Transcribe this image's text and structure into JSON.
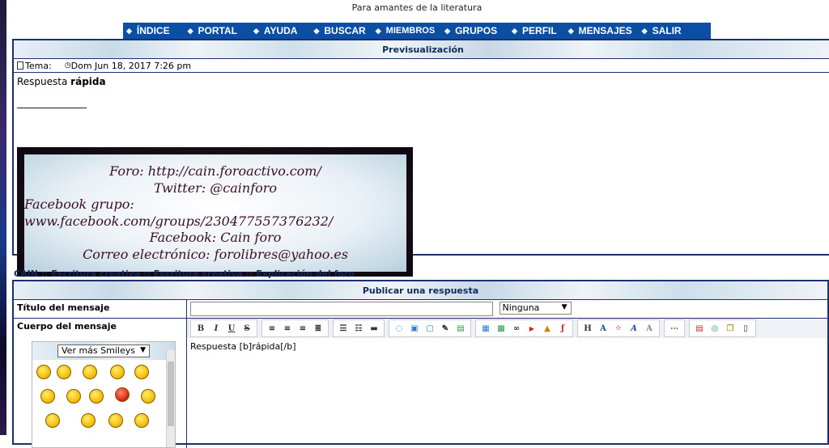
{
  "site": {
    "tagline": "Para amantes de la literatura"
  },
  "nav": {
    "items": [
      {
        "label": "ÍNDICE"
      },
      {
        "label": "PORTAL"
      },
      {
        "label": "AYUDA"
      },
      {
        "label": "BUSCAR"
      },
      {
        "label": "MIEMBROS"
      },
      {
        "label": "GRUPOS"
      },
      {
        "label": "PERFIL"
      },
      {
        "label": "MENSAJES"
      },
      {
        "label": "SALIR"
      }
    ]
  },
  "preview": {
    "header": "Previsualización",
    "topic_label": "Tema:",
    "date": "Dom Jun 18, 2017 7:26 pm",
    "body_plain": "Respuesta ",
    "body_bold": "rápida",
    "signature_rule": "_________________",
    "signature_lines": [
      "Foro: http://cain.foroactivo.com/",
      "Twitter: @cainforo",
      "Facebook grupo:  www.facebook.com/groups/230477557376232/",
      "Facebook: Cain foro",
      "Correo electrónico: forolibres@yahoo.es"
    ]
  },
  "breadcrumb": "CAIN  :: Escritura creativa :: Escritura creativa :: Explicación del foro",
  "reply": {
    "header": "Publicar una respuesta",
    "title_label": "Título del mensaje",
    "title_value": "",
    "icon_select": "Ninguna",
    "body_label": "Cuerpo del mensaje",
    "smiley_select": "Ver más Smileys",
    "editor_text": "Respuesta [b]rápida[/b]"
  },
  "toolbar": {
    "groups": [
      [
        "B",
        "I",
        "U",
        "S"
      ],
      [
        "align-left",
        "align-center",
        "align-right",
        "justify"
      ],
      [
        "bullet-list",
        "numbered-list",
        "horizontal-rule"
      ],
      [
        "speech",
        "image-upload",
        "insert-image",
        "edit-image",
        "attach"
      ],
      [
        "gallery",
        "media",
        "link",
        "youtube",
        "warning",
        "flash"
      ],
      [
        "H",
        "font",
        "color",
        "size",
        "clear"
      ],
      [
        "more"
      ],
      [
        "date",
        "search",
        "copy",
        "document"
      ]
    ]
  },
  "colors": {
    "nav": "#0a4fa3",
    "border": "#1c2f6e",
    "heading": "#0f2a5c"
  }
}
